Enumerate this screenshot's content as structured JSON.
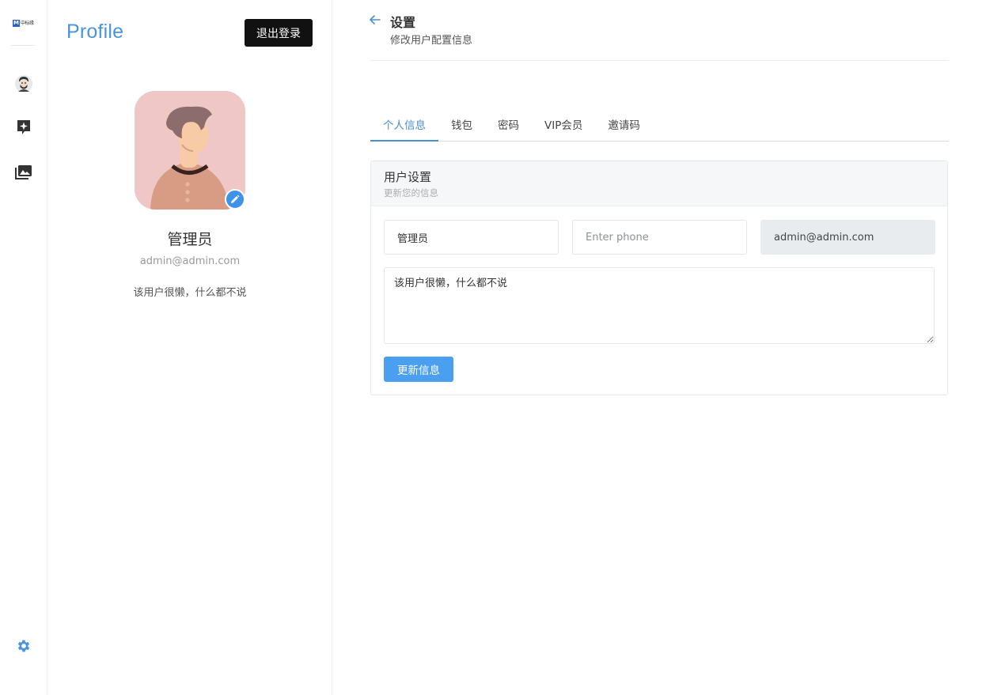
{
  "rail": {
    "logo_mark": "M",
    "logo_text": "中标缘",
    "items": [
      {
        "icon": "user-avatar-icon"
      },
      {
        "icon": "sparkle-chat-icon"
      },
      {
        "icon": "gallery-icon"
      }
    ],
    "settings_icon": "gear-icon"
  },
  "profile": {
    "title": "Profile",
    "logout_label": "退出登录",
    "name": "管理员",
    "email": "admin@admin.com",
    "bio": "该用户很懒，什么都不说"
  },
  "main": {
    "back_icon": "arrow-left-icon",
    "title": "设置",
    "subtitle": "修改用户配置信息",
    "tabs": [
      {
        "label": "个人信息",
        "active": true
      },
      {
        "label": "钱包",
        "active": false
      },
      {
        "label": "密码",
        "active": false
      },
      {
        "label": "VIP会员",
        "active": false
      },
      {
        "label": "邀请码",
        "active": false
      }
    ],
    "card": {
      "title": "用户设置",
      "subtitle": "更新您的信息",
      "name_value": "管理员",
      "phone_placeholder": "Enter phone",
      "email_value": "admin@admin.com",
      "bio_value": "该用户很懒，什么都不说",
      "submit_label": "更新信息"
    }
  },
  "colors": {
    "accent": "#4a95d9",
    "button_primary": "#4a9ff0",
    "button_dark": "#111111"
  }
}
